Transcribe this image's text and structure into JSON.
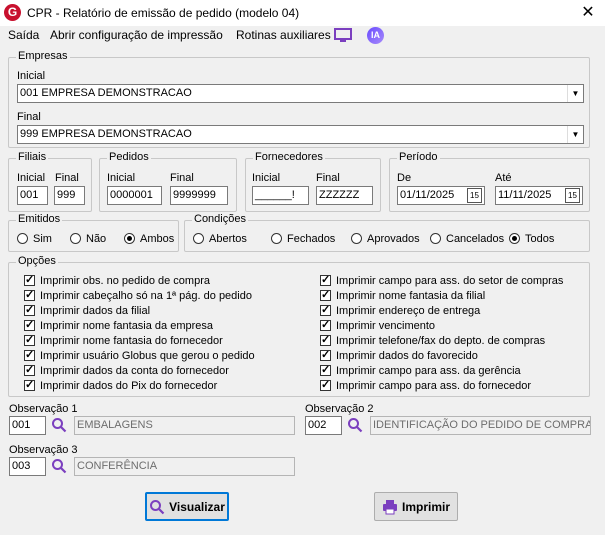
{
  "window": {
    "logo": "G",
    "title": "CPR - Relatório de emissão de pedido (modelo 04)",
    "close": "✕"
  },
  "menu": {
    "items": [
      "Saída",
      "Abrir configuração de impressão",
      "Rotinas auxiliares"
    ],
    "ia_label": "IA"
  },
  "empresas": {
    "legend": "Empresas",
    "inicial_label": "Inicial",
    "inicial_value": "001 EMPRESA DEMONSTRACAO",
    "final_label": "Final",
    "final_value": "999 EMPRESA DEMONSTRACAO"
  },
  "filiais": {
    "legend": "Filiais",
    "inicial_label": "Inicial",
    "inicial_value": "001",
    "final_label": "Final",
    "final_value": "999"
  },
  "pedidos": {
    "legend": "Pedidos",
    "inicial_label": "Inicial",
    "inicial_value": "0000001",
    "final_label": "Final",
    "final_value": "9999999"
  },
  "fornecedores": {
    "legend": "Fornecedores",
    "inicial_label": "Inicial",
    "inicial_value": "______!",
    "final_label": "Final",
    "final_value": "ZZZZZZ"
  },
  "periodo": {
    "legend": "Período",
    "de_label": "De",
    "de_value": "01/11/2025",
    "ate_label": "Até",
    "ate_value": "11/11/2025",
    "cal_glyph": "15"
  },
  "emitidos": {
    "legend": "Emitidos",
    "options": [
      "Sim",
      "Não",
      "Ambos"
    ],
    "selected": "Ambos"
  },
  "condicoes": {
    "legend": "Condições",
    "options": [
      "Abertos",
      "Fechados",
      "Aprovados",
      "Cancelados",
      "Todos"
    ],
    "selected": "Todos"
  },
  "opcoes": {
    "legend": "Opções",
    "left": [
      "Imprimir obs. no pedido de compra",
      "Imprimir cabeçalho só na 1ª pág. do pedido",
      "Imprimir dados da filial",
      "Imprimir nome fantasia da empresa",
      "Imprimir nome fantasia do fornecedor",
      "Imprimir usuário Globus que gerou o pedido",
      "Imprimir dados da conta do fornecedor",
      "Imprimir dados do Pix do fornecedor"
    ],
    "right": [
      "Imprimir campo para ass. do setor de compras",
      "Imprimir nome fantasia da filial",
      "Imprimir endereço de entrega",
      "Imprimir vencimento",
      "Imprimir telefone/fax do depto. de compras",
      "Imprimir dados do favorecido",
      "Imprimir campo para ass. da gerência",
      "Imprimir campo para ass. do fornecedor"
    ]
  },
  "observacoes": [
    {
      "label": "Observação 1",
      "code": "001",
      "desc": "EMBALAGENS"
    },
    {
      "label": "Observação 2",
      "code": "002",
      "desc": "IDENTIFICAÇÃO DO PEDIDO DE COMPRAS"
    },
    {
      "label": "Observação 3",
      "code": "003",
      "desc": "CONFERÊNCIA"
    }
  ],
  "buttons": {
    "visualizar": "Visualizar",
    "imprimir": "Imprimir"
  }
}
